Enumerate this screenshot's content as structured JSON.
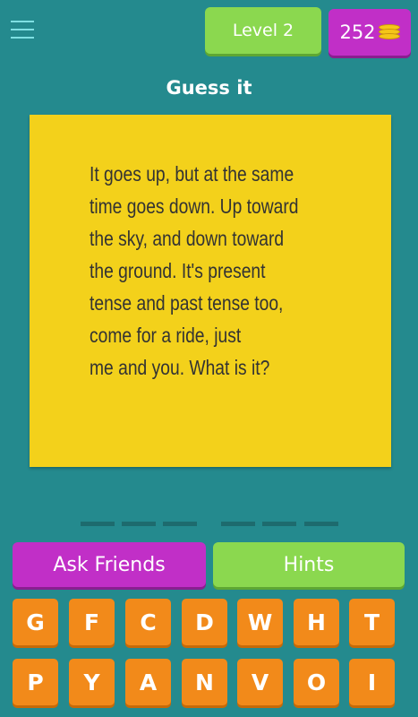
{
  "header": {
    "level_label": "Level 2",
    "coins": "252",
    "coin_icon": "coin-stack-icon",
    "menu_icon": "hamburger-menu-icon"
  },
  "title": "Guess it",
  "riddle": "It goes up, but at the same\ntime goes down. Up toward\nthe sky, and down toward\nthe ground. It's present\ntense and past tense too,\ncome for a ride, just\nme and you. What is it?",
  "answer_slots": {
    "word_lengths": [
      3,
      3
    ],
    "filled": [
      "",
      "",
      "",
      "",
      "",
      ""
    ]
  },
  "buttons": {
    "ask_friends": "Ask Friends",
    "hints": "Hints"
  },
  "keyboard": {
    "row1": [
      "G",
      "F",
      "C",
      "D",
      "W",
      "H",
      "T"
    ],
    "row2": [
      "P",
      "Y",
      "A",
      "N",
      "V",
      "O",
      "I"
    ]
  },
  "colors": {
    "background": "#248a8e",
    "card": "#f3d11b",
    "green": "#8bd84f",
    "purple": "#c12fc7",
    "orange": "#f28a1a"
  }
}
